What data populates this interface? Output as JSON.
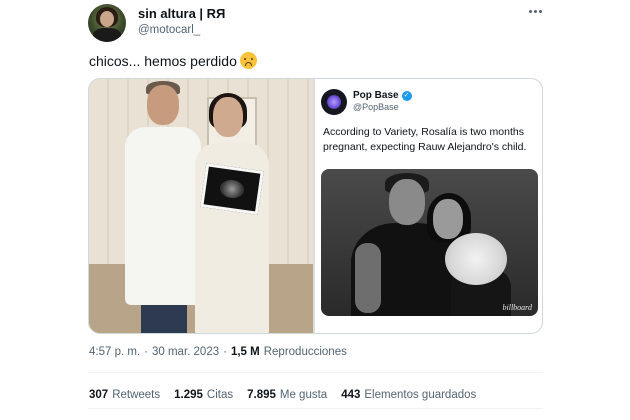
{
  "author": {
    "display_name": "sin altura | RЯ",
    "handle": "@motocarl_"
  },
  "tweet": {
    "text": "chicos... hemos perdido",
    "emoji": "sad-face-emoji"
  },
  "embedded": {
    "name": "Pop Base",
    "handle": "@PopBase",
    "text": "According to Variety, Rosalía is two months pregnant, expecting Rauw Alejandro's child.",
    "watermark": "billboard",
    "verified": true
  },
  "meta": {
    "time": "4:57 p. m.",
    "separator1": "·",
    "date": "30 mar. 2023",
    "separator2": "·",
    "views_count": "1,5 M",
    "views_label": "Reproducciones"
  },
  "stats": {
    "retweets_count": "307",
    "retweets_label": "Retweets",
    "quotes_count": "1.295",
    "quotes_label": "Citas",
    "likes_count": "7.895",
    "likes_label": "Me gusta",
    "bookmarks_count": "443",
    "bookmarks_label": "Elementos guardados"
  },
  "colors": {
    "text": "#0f1419",
    "secondary": "#536471",
    "verified": "#1d9bf0",
    "border": "#cfd9de"
  }
}
